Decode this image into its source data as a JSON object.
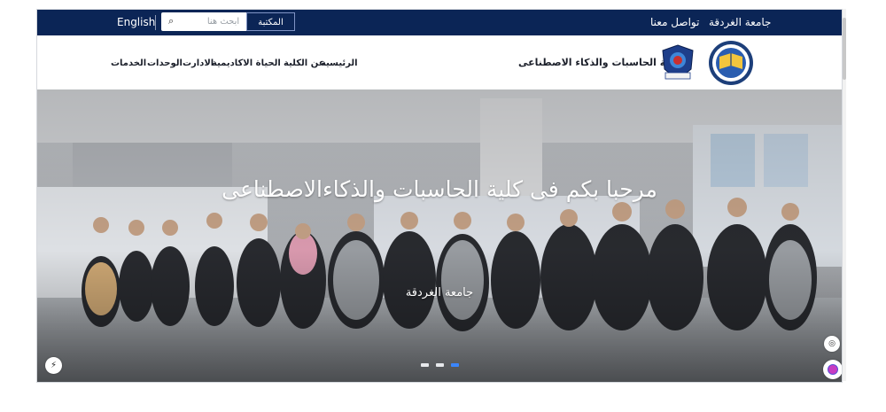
{
  "topbar": {
    "language_label": "English",
    "search_placeholder": "ابحث هنا",
    "library_button": "المكتبة",
    "contact_label": "تواصل معنا",
    "university_label": "جامعة الغردقة"
  },
  "header": {
    "college_name": "كلية الحاسبات والذكاء الاصطناعى",
    "nav_items": [
      "الرئيسية",
      "عن الكلية",
      "الحياة الاكاديمية",
      "الادارت",
      "الوحدات",
      "الخدمات"
    ]
  },
  "hero": {
    "title": "مرحبا بكم فى كلية الحاسبات والذكاءالاصطناعى",
    "subtitle": "جامعة الغردقة",
    "active_slide": 3,
    "slide_count": 3
  },
  "icons": {
    "search": "search-icon",
    "accessibility": "accessibility-icon",
    "bolt": "bolt-icon",
    "chat": "chat-icon"
  },
  "colors": {
    "topbar_bg": "#0b2556",
    "active_dot": "#3a86ff",
    "text_dark": "#1b1f2a"
  }
}
